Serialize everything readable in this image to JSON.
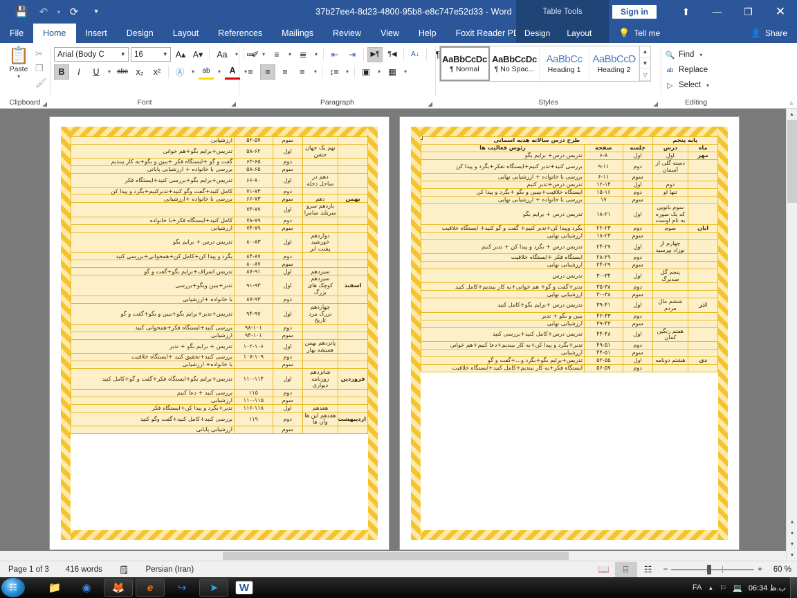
{
  "titlebar": {
    "document_title": "37b27ee4-8d23-4800-95b8-e8c747e52d33  -  Word",
    "contextual_tools": "Table Tools",
    "sign_in": "Sign in",
    "qat": [
      {
        "name": "save-icon",
        "glyph": "💾"
      },
      {
        "name": "undo-icon",
        "glyph": "↶"
      },
      {
        "name": "undo-dropdown-icon",
        "glyph": "▾"
      },
      {
        "name": "redo-icon",
        "glyph": "⟳"
      },
      {
        "name": "customize-qat-icon",
        "glyph": "⯆"
      }
    ],
    "window_controls": [
      {
        "name": "ribbon-display-options-icon",
        "glyph": "⬆"
      },
      {
        "name": "minimize-icon",
        "glyph": "—"
      },
      {
        "name": "restore-icon",
        "glyph": "❐"
      },
      {
        "name": "close-icon",
        "glyph": "✕"
      }
    ]
  },
  "tabs": {
    "main": [
      "File",
      "Home",
      "Insert",
      "Design",
      "Layout",
      "References",
      "Mailings",
      "Review",
      "View",
      "Help",
      "Foxit Reader PDF"
    ],
    "active": "Home",
    "table_tools": [
      "Design",
      "Layout"
    ],
    "tell_me": "Tell me",
    "share": "Share"
  },
  "ribbon": {
    "clipboard": {
      "label": "Clipboard",
      "paste": "Paste",
      "icons": [
        {
          "name": "cut-icon",
          "glyph": "✂"
        },
        {
          "name": "copy-icon",
          "glyph": "❐"
        },
        {
          "name": "format-painter-icon",
          "glyph": "🖌"
        }
      ]
    },
    "font": {
      "label": "Font",
      "font_name": "Arial (Body C",
      "font_size": "16",
      "buttons": [
        {
          "name": "grow-font-icon",
          "glyph": "A▴"
        },
        {
          "name": "shrink-font-icon",
          "glyph": "A▾"
        },
        {
          "name": "change-case-icon",
          "glyph": "Aa"
        },
        {
          "name": "clear-formatting-icon",
          "glyph": "✐"
        },
        {
          "name": "bold-button",
          "glyph": "B"
        },
        {
          "name": "italic-button",
          "glyph": "I"
        },
        {
          "name": "underline-button",
          "glyph": "U"
        },
        {
          "name": "strikethrough-button",
          "glyph": "abc"
        },
        {
          "name": "subscript-button",
          "glyph": "x₂"
        },
        {
          "name": "superscript-button",
          "glyph": "x²"
        },
        {
          "name": "text-effects-icon",
          "glyph": "A"
        },
        {
          "name": "text-highlight-icon",
          "glyph": "ab"
        },
        {
          "name": "font-color-icon",
          "glyph": "A"
        }
      ]
    },
    "paragraph": {
      "label": "Paragraph",
      "buttons": [
        {
          "name": "bullets-icon",
          "glyph": "≔"
        },
        {
          "name": "numbering-icon",
          "glyph": "≡"
        },
        {
          "name": "multilevel-list-icon",
          "glyph": "≣"
        },
        {
          "name": "decrease-indent-icon",
          "glyph": "⇤"
        },
        {
          "name": "increase-indent-icon",
          "glyph": "⇥"
        },
        {
          "name": "ltr-text-direction-icon",
          "glyph": "▶¶"
        },
        {
          "name": "rtl-text-direction-icon",
          "glyph": "¶◀"
        },
        {
          "name": "sort-icon",
          "glyph": "A↓"
        },
        {
          "name": "show-formatting-marks-icon",
          "glyph": "¶"
        },
        {
          "name": "align-left-icon",
          "glyph": "≡"
        },
        {
          "name": "align-center-icon",
          "glyph": "≡"
        },
        {
          "name": "align-right-icon",
          "glyph": "≡"
        },
        {
          "name": "justify-icon",
          "glyph": "≡"
        },
        {
          "name": "line-spacing-icon",
          "glyph": "↕"
        },
        {
          "name": "shading-icon",
          "glyph": "▣"
        },
        {
          "name": "borders-icon",
          "glyph": "▦"
        }
      ]
    },
    "styles": {
      "label": "Styles",
      "items": [
        {
          "preview": "AaBbCcDc",
          "name": "¶ Normal",
          "selected": true,
          "heading": false
        },
        {
          "preview": "AaBbCcDc",
          "name": "¶ No Spac...",
          "selected": false,
          "heading": false
        },
        {
          "preview": "AaBbCс",
          "name": "Heading 1",
          "selected": false,
          "heading": true
        },
        {
          "preview": "AaBbCcD",
          "name": "Heading 2",
          "selected": false,
          "heading": true
        }
      ]
    },
    "editing": {
      "label": "Editing",
      "find": "Find",
      "replace": "Replace",
      "select": "Select"
    }
  },
  "document": {
    "table_header_title": "طرح درس سالانه هدیه اسمانی",
    "table_header_grade": "پایه پنجم",
    "columns": [
      "ماه",
      "درس",
      "جلسه",
      "صفحه",
      "رئوس فعالیت ها"
    ],
    "page_right_rows": [
      {
        "month": "مهر",
        "lesson": "اول",
        "session": "اول",
        "pages": "۶-۸",
        "activities": "تدریس درس+ برایم بگو",
        "white": true
      },
      {
        "month": "",
        "lesson": "دسته گلی از آسمان",
        "session": "دوم",
        "pages": "۹-۱۱",
        "activities": "بررسی کنید+تدبر کنیم+ایستگاه تفکر+بگرد و پیدا کن",
        "white": false
      },
      {
        "month": "",
        "lesson": "",
        "session": "سوم",
        "pages": "۶-۱۱",
        "activities": "بررسی با خانواده + ارزشیابی نهایی",
        "white": true
      },
      {
        "month": "",
        "lesson": "دوم",
        "session": "اول",
        "pages": "۱۲-۱۴",
        "activities": "تدریس درس+تدبر کنیم",
        "white": false
      },
      {
        "month": "",
        "lesson": "تنها او",
        "session": "دوم",
        "pages": "۱۵-۱۶",
        "activities": "ایستگاه خلاقیت+بیبین و بگو +بگرد و پیدا کن",
        "white": false
      },
      {
        "month": "",
        "lesson": "",
        "session": "سوم",
        "pages": "۱۷",
        "activities": "بررسی با خانواده + ارزشیابی نهایی",
        "white": true
      },
      {
        "month": "",
        "lesson": "سوم بانویی که یک سوره به نام اوست",
        "session": "اول",
        "pages": "۱۸-۲۱",
        "activities": "تدریس درس + برایم بگو",
        "white": false
      },
      {
        "month": "ابان",
        "lesson": "سوم",
        "session": "دوم",
        "pages": "۲۲-۲۳",
        "activities": "بگرد وپیدا کن+تدبر کنیم+ گفت و گو کنید+ ایستگاه خلاقیت",
        "white": false
      },
      {
        "month": "",
        "lesson": "",
        "session": "سوم",
        "pages": "۱۸-۲۳",
        "activities": "ارزشیابی نهایی",
        "white": true
      },
      {
        "month": "",
        "lesson": "چهارم از نوزاد بپرسید",
        "session": "اول",
        "pages": "۲۴-۲۷",
        "activities": "تدریس درس + بگرد و پیدا کن + تدبر کنیم",
        "white": false
      },
      {
        "month": "",
        "lesson": "",
        "session": "دوم",
        "pages": "۲۸-۲۹",
        "activities": "ایستگاه فکر +ایستگاه خلاقیت",
        "white": false
      },
      {
        "month": "",
        "lesson": "",
        "session": "سوم",
        "pages": "۲۴-۲۹",
        "activities": "ارزشیابی نهایی",
        "white": true
      },
      {
        "month": "",
        "lesson": "پنجم گل صدبرگ",
        "session": "اول",
        "pages": "۳۰-۳۴",
        "activities": "تدریس درس",
        "white": false
      },
      {
        "month": "",
        "lesson": "",
        "session": "دوم",
        "pages": "۳۵-۳۸",
        "activities": "تدبر+گفت و گو+ هم خوانی+به کار ببندیم+کامل کنید",
        "white": false
      },
      {
        "month": "",
        "lesson": "",
        "session": "سوم",
        "pages": "۳۰-۳۸",
        "activities": "ارزشیابی نهایی",
        "white": true
      },
      {
        "month": "اذر",
        "lesson": "ششم مال مردم",
        "session": "اول",
        "pages": "۳۹-۴۱",
        "activities": "تدریس درس +برایم بگو+کامل کنید",
        "white": false
      },
      {
        "month": "",
        "lesson": "",
        "session": "دوم",
        "pages": "۴۲-۴۳",
        "activities": "ببین و بگو + تدبر",
        "white": false
      },
      {
        "month": "",
        "lesson": "",
        "session": "سوم",
        "pages": "۳۹-۴۳",
        "activities": "ارزشیابی نهایی",
        "white": true
      },
      {
        "month": "",
        "lesson": "هفتم رنگین کمان",
        "session": "اول",
        "pages": "۴۴-۴۸",
        "activities": "تدریس درس+کامل کنید+بررسی کنید",
        "white": false
      },
      {
        "month": "",
        "lesson": "",
        "session": "دوم",
        "pages": "۴۹-۵۱",
        "activities": "تدبر+بگرد و پیدا کن+به کار ببندیم+دعا کنیم+هم خوانی",
        "white": false
      },
      {
        "month": "",
        "lesson": "",
        "session": "سوم",
        "pages": "۴۴-۵۱",
        "activities": "ارزشیابی",
        "white": true
      },
      {
        "month": "دی",
        "lesson": "هشتم دونامه",
        "session": "اول",
        "pages": "۵۲-۵۵",
        "activities": "تدریس+برایم بگو+بگرد و...+گفت و گو",
        "white": false
      },
      {
        "month": "",
        "lesson": "",
        "session": "دوم",
        "pages": "۵۶-۵۷",
        "activities": "ایستگاه فکر+به کار ببندیم+کامل کنید+ایستگاه خلاقیت",
        "white": false
      }
    ],
    "page_left_rows": [
      {
        "month": "",
        "lesson": "",
        "session": "سوم",
        "pages": "۵۲-۵۷",
        "activities": "ارزشیابی",
        "white": false
      },
      {
        "month": "",
        "lesson": "نهم یک جهان جشن",
        "session": "اول",
        "pages": "۵۸-۶۲",
        "activities": "تدریس+برایم بگو+هم خوانی",
        "white": true
      },
      {
        "month": "",
        "lesson": "",
        "session": "دوم",
        "pages": "۶۳-۶۵",
        "activities": "گفت و گو +ایستگاه فکر +ببین و بگو+به کار ببندیم",
        "white": false
      },
      {
        "month": "",
        "lesson": "",
        "session": "سوم",
        "pages": "۵۸-۶۵",
        "activities": "بررسی با خانواده + ارزشیابی پایانی",
        "white": true
      },
      {
        "month": "",
        "lesson": "دهم در ساحل دجله",
        "session": "اول",
        "pages": "۶۶-۷۰",
        "activities": "تدریس+برایم بگو+بررسی کنید+ایستگاه فکر",
        "white": false
      },
      {
        "month": "",
        "lesson": "",
        "session": "دوم",
        "pages": "۷۱-۷۳",
        "activities": "کامل کنید+گفت وگو کنید+تدبرکنیم+بگرد و پیدا کن",
        "white": false
      },
      {
        "month": "بهمن",
        "lesson": "دهم",
        "session": "سوم",
        "pages": "۶۶-۷۳",
        "activities": "بررسی با خانواده +ارزشیابی",
        "white": false
      },
      {
        "month": "",
        "lesson": "یازدهم سرو سربلند سامرا",
        "session": "اول",
        "pages": "۷۴-۷۷",
        "activities": "",
        "white": true
      },
      {
        "month": "",
        "lesson": "",
        "session": "دوم",
        "pages": "۷۸-۷۹",
        "activities": "کامل کنید+ایستگاه فکر+با خانواده",
        "white": false
      },
      {
        "month": "",
        "lesson": "",
        "session": "سوم",
        "pages": "۷۴-۷۹",
        "activities": "ارزشیابی",
        "white": false
      },
      {
        "month": "",
        "lesson": "دوازدهم خورشید پشت ابر",
        "session": "اول",
        "pages": "۸۰-۸۳",
        "activities": "تدریس درس + برایم بگو",
        "white": true
      },
      {
        "month": "",
        "lesson": "",
        "session": "دوم",
        "pages": "۸۴-۸۷",
        "activities": "بگرد و پیدا کن+کامل کن+همخوانی+بررسی کنید",
        "white": false
      },
      {
        "month": "",
        "lesson": "",
        "session": "سوم",
        "pages": "۸۰-۸۷",
        "activities": "",
        "white": false
      },
      {
        "month": "",
        "lesson": "سیزدهم",
        "session": "اول",
        "pages": "۸۷-۹۱",
        "activities": "تدریس اسراف+برایم بگو+گفت و گو",
        "white": true
      },
      {
        "month": "اسفند",
        "lesson": "سیزدهم کوچک های بزرگ",
        "session": "اول",
        "pages": "۹۱-۹۳",
        "activities": "تدبر+ببین وبگو+بررسی",
        "white": false
      },
      {
        "month": "",
        "lesson": "",
        "session": "دوم",
        "pages": "۸۷-۹۳",
        "activities": "با خانواده +ارزشیابی",
        "white": true
      },
      {
        "month": "",
        "lesson": "چهاردهم بزرگ مرد تاریخ",
        "session": "اول",
        "pages": "۹۴-۹۷",
        "activities": "تدریس+تدبر+برایم بگو+ببین و بگو+گفت و گو",
        "white": false
      },
      {
        "month": "",
        "lesson": "",
        "session": "دوم",
        "pages": "۹۸-۱۰۱",
        "activities": "بررسی کنید+ایستگاه فکر+همخوانی کنید",
        "white": true
      },
      {
        "month": "",
        "lesson": "",
        "session": "سوم",
        "pages": "۹۴-۱۰۱",
        "activities": "ارزشیابی",
        "white": false
      },
      {
        "month": "",
        "lesson": "پانزدهم بهمن همیشه بهار",
        "session": "اول",
        "pages": "۱۰۲-۱۰۶",
        "activities": "تدریس + برایم بگو + تدبر",
        "white": true
      },
      {
        "month": "",
        "lesson": "",
        "session": "دوم",
        "pages": "۱۰۷-۱۰۹",
        "activities": "بررسی کنید+تحقیق کنید +ایستگاه خلاقیت",
        "white": false
      },
      {
        "month": "",
        "lesson": "",
        "session": "سوم",
        "pages": "",
        "activities": "با خانواده+ ارزشیابی",
        "white": false
      },
      {
        "month": "فروردین",
        "lesson": "شانزدهم روزنامه دیواری",
        "session": "اول",
        "pages": "۱۱۰-۱۱۴",
        "activities": "تدریس+برایم بگو+ایستگاه فکر+گفت و گو+کامل کنید",
        "white": false
      },
      {
        "month": "",
        "lesson": "",
        "session": "دوم",
        "pages": "۱۱۵",
        "activities": "بررسی کنید + دعا کنیم",
        "white": true
      },
      {
        "month": "",
        "lesson": "",
        "session": "سوم",
        "pages": "۱۱۰-۱۱۵",
        "activities": "ارزشیابی",
        "white": false
      },
      {
        "month": "",
        "lesson": "هفدهم",
        "session": "اول",
        "pages": "۱۱۶-۱۱۸",
        "activities": "تدبر+بگرد و پیدا کن+ایستگاه فکر",
        "white": true
      },
      {
        "month": "اردیبهشت",
        "lesson": "هفدهم این ها وآن ها",
        "session": "دوم",
        "pages": "۱۱۹",
        "activities": "بررسی کنید+کامل کنید+گفت وگو کنید",
        "white": false
      },
      {
        "month": "",
        "lesson": "",
        "session": "سوم",
        "pages": "",
        "activities": "ارزشیابی پایانی",
        "white": true
      }
    ]
  },
  "status": {
    "page": "Page 1 of 3",
    "words": "416 words",
    "proofing_icon": "proofing-errors-icon",
    "language": "Persian (Iran)",
    "views": [
      {
        "name": "read-mode-icon",
        "glyph": "📖",
        "active": false
      },
      {
        "name": "print-layout-icon",
        "glyph": "⌸",
        "active": true
      },
      {
        "name": "web-layout-icon",
        "glyph": "☷",
        "active": false
      }
    ],
    "zoom_out": "−",
    "zoom_in": "+",
    "zoom_value": "60 %"
  },
  "taskbar": {
    "start": "start-orb",
    "items": [
      {
        "name": "file-explorer-icon",
        "glyph": "📁",
        "framed": false
      },
      {
        "name": "google-chrome-icon",
        "glyph": "◉",
        "framed": false
      },
      {
        "name": "firefox-icon",
        "glyph": "🦊",
        "framed": true
      },
      {
        "name": "internet-browser-icon",
        "glyph": "e",
        "framed": true
      },
      {
        "name": "idm-icon",
        "glyph": "↪",
        "framed": false
      },
      {
        "name": "telegram-icon",
        "glyph": "➤",
        "framed": true
      },
      {
        "name": "word-taskbar-icon",
        "glyph": "W",
        "framed": true
      }
    ],
    "tray": {
      "language": "FA",
      "show_hidden": "▲",
      "flag_icon": "language-flag-icon",
      "network_icon": "network-icon",
      "clock": "06:34 ب.ظ"
    }
  }
}
